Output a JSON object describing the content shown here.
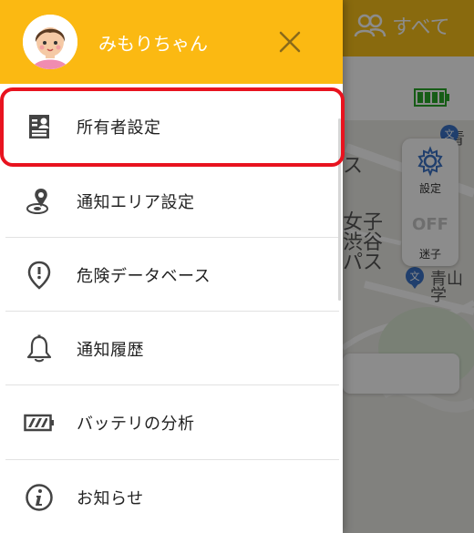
{
  "user": {
    "name": "みもりちゃん"
  },
  "background": {
    "filter_label": "すべて",
    "map_labels": [
      "青",
      "ス",
      "女子",
      "渋谷",
      "パス",
      "青山学"
    ],
    "fab": {
      "settings_label": "設定",
      "off_label": "OFF",
      "lost_label": "迷子"
    }
  },
  "menu": [
    {
      "label": "所有者設定",
      "icon": "id-card-icon"
    },
    {
      "label": "通知エリア設定",
      "icon": "area-pin-icon"
    },
    {
      "label": "危険データベース",
      "icon": "danger-pin-icon"
    },
    {
      "label": "通知履歴",
      "icon": "bell-icon"
    },
    {
      "label": "バッテリの分析",
      "icon": "battery-icon"
    },
    {
      "label": "お知らせ",
      "icon": "info-icon"
    }
  ],
  "colors": {
    "header": "#fbb912",
    "highlight": "#e8131f",
    "battery_green": "#29a829"
  }
}
